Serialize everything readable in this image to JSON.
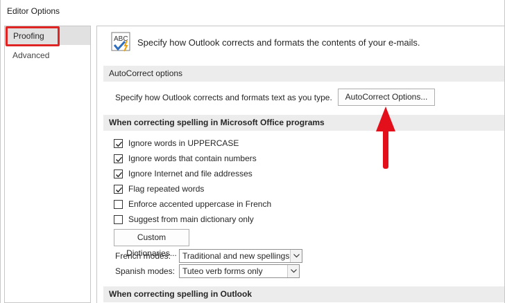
{
  "window": {
    "title": "Editor Options"
  },
  "sidebar": {
    "items": [
      {
        "label": "Proofing",
        "selected": true
      },
      {
        "label": "Advanced",
        "selected": false
      }
    ]
  },
  "header": {
    "text": "Specify how Outlook corrects and formats the contents of your e-mails.",
    "icon": "abc-check-icon"
  },
  "autocorrect": {
    "section_title": "AutoCorrect options",
    "description": "Specify how Outlook corrects and formats text as you type.",
    "button_label": "AutoCorrect Options..."
  },
  "spelling_office": {
    "section_title": "When correcting spelling in Microsoft Office programs",
    "checkboxes": [
      {
        "label": "Ignore words in UPPERCASE",
        "checked": true
      },
      {
        "label": "Ignore words that contain numbers",
        "checked": true
      },
      {
        "label": "Ignore Internet and file addresses",
        "checked": true
      },
      {
        "label": "Flag repeated words",
        "checked": true
      },
      {
        "label": "Enforce accented uppercase in French",
        "checked": false
      },
      {
        "label": "Suggest from main dictionary only",
        "checked": false
      }
    ],
    "custom_dictionaries_label": "Custom Dictionaries...",
    "french_modes_label": "French modes:",
    "french_modes_value": "Traditional and new spellings",
    "spanish_modes_label": "Spanish modes:",
    "spanish_modes_value": "Tuteo verb forms only"
  },
  "spelling_outlook": {
    "section_title": "When correcting spelling in Outlook"
  },
  "annotation": {
    "highlight_color": "#e02424",
    "arrow_color": "#e3101b"
  }
}
